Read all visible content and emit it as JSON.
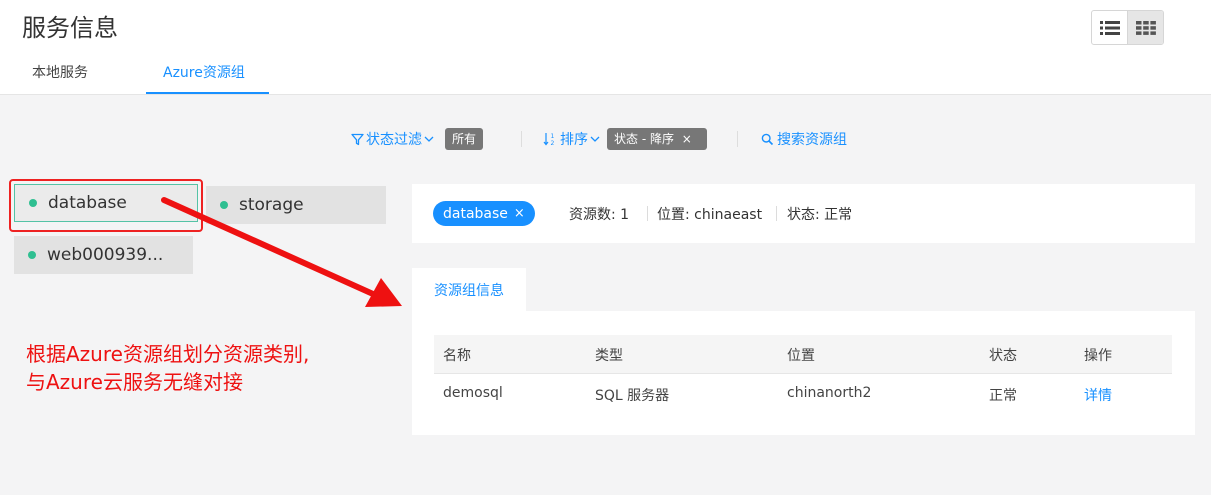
{
  "header": {
    "title": "服务信息",
    "tabs": [
      {
        "label": "本地服务",
        "active": false
      },
      {
        "label": "Azure资源组",
        "active": true
      }
    ],
    "view_toggle": {
      "list_icon": "list-icon",
      "grid_icon": "grid-icon",
      "active": "grid"
    }
  },
  "filter_bar": {
    "status_filter_label": "状态过滤",
    "status_filter_value": "所有",
    "sort_label": "排序",
    "sort_value": "状态 - 降序",
    "sort_clear": "×",
    "search_label": "搜索资源组"
  },
  "groups": [
    {
      "label": "database",
      "selected": true,
      "status_color": "#2fbf91"
    },
    {
      "label": "storage",
      "selected": false,
      "status_color": "#2fbf91"
    },
    {
      "label": "web000939...",
      "selected": false,
      "status_color": "#2fbf91"
    }
  ],
  "info": {
    "chip_label": "database",
    "chip_close": "×",
    "resource_count": "资源数: 1",
    "location": "位置: chinaeast",
    "status": "状态: 正常"
  },
  "detail": {
    "tab_label": "资源组信息",
    "columns": [
      "名称",
      "类型",
      "位置",
      "状态",
      "操作"
    ],
    "rows": [
      {
        "name": "demosql",
        "type": "SQL 服务器",
        "location": "chinanorth2",
        "status": "正常",
        "action": "详情"
      }
    ]
  },
  "annotation": {
    "line1": "根据Azure资源组划分资源类别,",
    "line2": "与Azure云服务无缝对接"
  },
  "colors": {
    "accent": "#1890ff",
    "status_ok": "#2fbf91",
    "annotation": "#ee1111",
    "tag_gray": "#777777"
  }
}
